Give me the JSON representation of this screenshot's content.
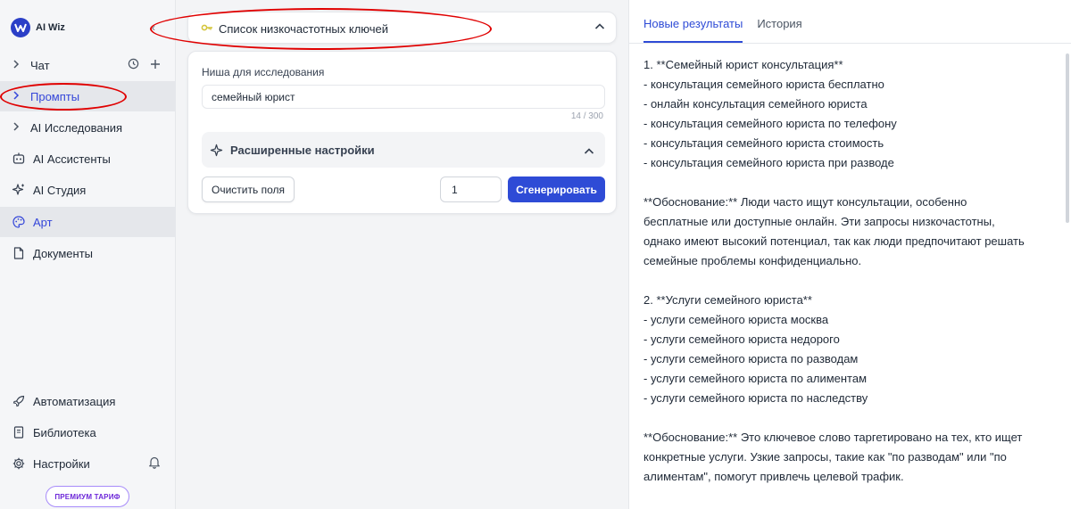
{
  "sidebar": {
    "logo_text": "AI Wiz",
    "items": [
      {
        "label": "Чат"
      },
      {
        "label": "Промпты"
      },
      {
        "label": "AI Исследования"
      },
      {
        "label": "AI Ассистенты"
      },
      {
        "label": "AI Студия"
      },
      {
        "label": "Арт"
      },
      {
        "label": "Документы"
      }
    ],
    "bottom": [
      {
        "label": "Автоматизация"
      },
      {
        "label": "Библиотека"
      },
      {
        "label": "Настройки"
      }
    ],
    "premium_label": "ПРЕМИУМ ТАРИФ"
  },
  "prompt": {
    "title": "Список низкочастотных ключей",
    "field_label": "Ниша для исследования",
    "field_value": "семейный юрист",
    "counter": "14 / 300",
    "advanced_label": "Расширенные настройки",
    "clear_label": "Очистить поля",
    "count_value": "1",
    "generate_label": "Сгенерировать"
  },
  "results": {
    "tabs": [
      {
        "label": "Новые результаты"
      },
      {
        "label": "История"
      }
    ],
    "lines": [
      "1. **Семейный юрист консультация**",
      "- консультация семейного юриста бесплатно",
      "- онлайн консультация семейного юриста",
      "- консультация семейного юриста по телефону",
      "- консультация семейного юриста стоимость",
      "- консультация семейного юриста при разводе",
      "",
      "**Обоснование:** Люди часто ищут консультации, особенно",
      "бесплатные или доступные онлайн. Эти запросы низкочастотны,",
      "однако имеют высокий потенциал, так как люди предпочитают решать",
      "семейные проблемы конфиденциально.",
      "",
      "2. **Услуги семейного юриста**",
      "- услуги семейного юриста москва",
      "- услуги семейного юриста недорого",
      "- услуги семейного юриста по разводам",
      "- услуги семейного юриста по алиментам",
      "- услуги семейного юриста по наследству",
      "",
      "**Обоснование:** Это ключевое слово таргетировано на тех, кто ищет",
      "конкретные услуги. Узкие запросы, такие как \"по разводам\" или \"по",
      "алиментам\", помогут привлечь целевой трафик."
    ]
  },
  "colors": {
    "accent": "#2e4bd6",
    "annotation": "#e00000",
    "premium": "#6d28d9"
  }
}
